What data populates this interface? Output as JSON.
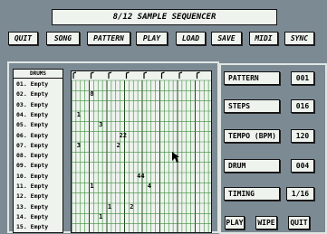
{
  "app": {
    "title": "8/12 SAMPLE SEQUENCER"
  },
  "menu": [
    {
      "label": "QUIT"
    },
    {
      "label": "SONG"
    },
    {
      "label": "PATTERN"
    },
    {
      "label": "PLAY"
    },
    {
      "label": "LOAD"
    },
    {
      "label": "SAVE"
    },
    {
      "label": "MIDI"
    },
    {
      "label": "SYNC"
    }
  ],
  "drums": {
    "header": "DRUMS",
    "items": [
      "01. Empty",
      "02. Empty",
      "03. Empty",
      "04. Empty",
      "05. Empty",
      "06. Empty",
      "07. Empty",
      "08. Empty",
      "09. Empty",
      "10. Empty",
      "11. Empty",
      "12. Empty",
      "13. Empty",
      "14. Empty",
      "15. Empty"
    ]
  },
  "grid": {
    "columns": 32,
    "rows": 15,
    "notes": [
      {
        "row": 1,
        "col": 4,
        "text": "8"
      },
      {
        "row": 3,
        "col": 1,
        "text": "1"
      },
      {
        "row": 4,
        "col": 6,
        "text": "3"
      },
      {
        "row": 5,
        "col": 11,
        "text": "22"
      },
      {
        "row": 6,
        "col": 1,
        "text": "3"
      },
      {
        "row": 6,
        "col": 10,
        "text": "2"
      },
      {
        "row": 9,
        "col": 15,
        "text": "44"
      },
      {
        "row": 10,
        "col": 4,
        "text": "1"
      },
      {
        "row": 10,
        "col": 17,
        "text": "4"
      },
      {
        "row": 12,
        "col": 8,
        "text": "1"
      },
      {
        "row": 12,
        "col": 13,
        "text": "2"
      },
      {
        "row": 13,
        "col": 6,
        "text": "1"
      }
    ]
  },
  "controls": {
    "pattern": {
      "label": "PATTERN",
      "value": "001"
    },
    "steps": {
      "label": "STEPS",
      "value": "016"
    },
    "tempo": {
      "label": "TEMPO (BPM)",
      "value": "120"
    },
    "drum": {
      "label": "DRUM",
      "value": "004"
    },
    "timing": {
      "label": "TIMING",
      "value": "1/16"
    }
  },
  "bottom": {
    "play": "PLAY",
    "wipe": "WIPE",
    "quit": "QUIT"
  }
}
